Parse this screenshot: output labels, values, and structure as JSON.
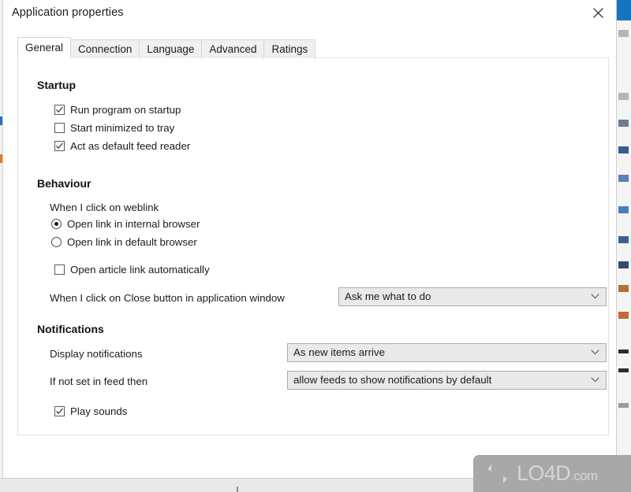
{
  "window": {
    "title": "Application properties",
    "close_icon": "close-icon"
  },
  "tabs": [
    {
      "label": "General",
      "active": true
    },
    {
      "label": "Connection",
      "active": false
    },
    {
      "label": "Language",
      "active": false
    },
    {
      "label": "Advanced",
      "active": false
    },
    {
      "label": "Ratings",
      "active": false
    }
  ],
  "sections": {
    "startup": {
      "heading": "Startup",
      "checkboxes": [
        {
          "label": "Run program on startup",
          "checked": true
        },
        {
          "label": "Start minimized to tray",
          "checked": false
        },
        {
          "label": "Act as default feed reader",
          "checked": true
        }
      ]
    },
    "behaviour": {
      "heading": "Behaviour",
      "weblink_label": "When I click on weblink",
      "radios": [
        {
          "label": "Open link in internal browser",
          "checked": true
        },
        {
          "label": "Open link in default browser",
          "checked": false
        }
      ],
      "auto_open_checkbox": {
        "label": "Open article link automatically",
        "checked": false
      },
      "close_button_label": "When I click on Close button in application window",
      "close_button_value": "Ask me what to do"
    },
    "notifications": {
      "heading": "Notifications",
      "display_label": "Display notifications",
      "display_value": "As new items arrive",
      "fallback_label": "If not set in feed then",
      "fallback_value": "allow feeds to show notifications by default",
      "play_sounds": {
        "label": "Play sounds",
        "checked": true
      }
    }
  },
  "watermark": {
    "text": "LO4D",
    "suffix": ".com",
    "icon": "refresh-arrows-icon"
  },
  "colors": {
    "dialog_bg": "#ffffff",
    "desktop_bg": "#efefef",
    "tab_inactive": "#f0f0f0",
    "combo_bg": "#e9e9e9",
    "combo_border": "#acacac",
    "text": "#1b1b1b",
    "watermark_bg": "#a8a8a8",
    "bg_window_titlebar": "#1675c0"
  }
}
